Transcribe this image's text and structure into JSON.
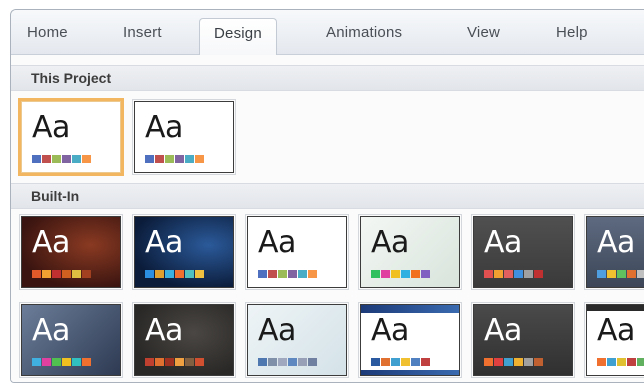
{
  "ribbon": {
    "tabs": [
      {
        "label": "Home"
      },
      {
        "label": "Insert"
      },
      {
        "label": "Design"
      },
      {
        "label": "Animations"
      },
      {
        "label": "View"
      },
      {
        "label": "Help"
      }
    ],
    "active_tab": "Design"
  },
  "gallery": {
    "this_project": {
      "label": "This Project",
      "themes": [
        {
          "sample": "Aa",
          "selected": true
        },
        {
          "sample": "Aa",
          "selected": false
        }
      ]
    },
    "built_in": {
      "label": "Built-In",
      "themes": [
        {
          "sample": "Aa"
        },
        {
          "sample": "Aa"
        },
        {
          "sample": "Aa"
        },
        {
          "sample": "Aa"
        },
        {
          "sample": "Aa"
        },
        {
          "sample": "Aa"
        },
        {
          "sample": "Aa"
        },
        {
          "sample": "Aa"
        },
        {
          "sample": "Aa"
        },
        {
          "sample": "Aa"
        },
        {
          "sample": "Aa"
        },
        {
          "sample": "Aa"
        }
      ]
    }
  },
  "colors": {
    "selection_outline": "#f3b660",
    "swatch_palette_default": [
      "#4f6fbf",
      "#c0504d",
      "#9bbb59",
      "#8064a2",
      "#4bacc6",
      "#f79646"
    ]
  }
}
